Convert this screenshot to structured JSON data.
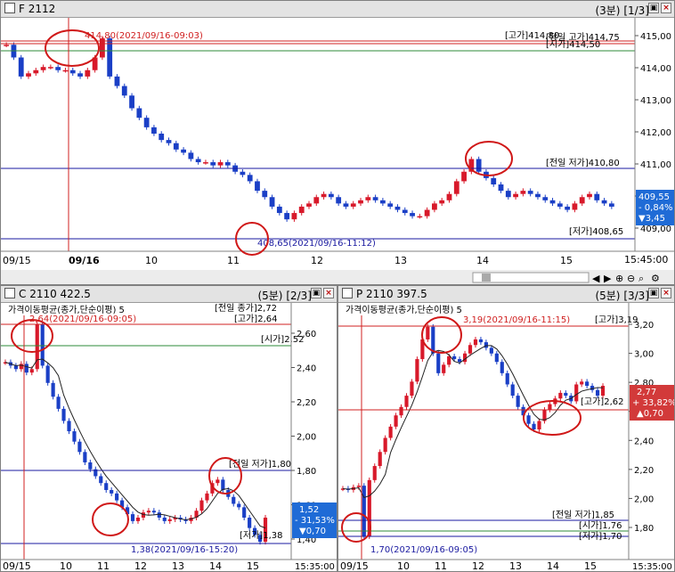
{
  "top": {
    "title": "F 2112",
    "interval": "(3분)",
    "page": "[1/3]",
    "high_label": "[고가]414,80",
    "high_overlap": "[당일 고가]414,75",
    "open_label": "[시가]414,50",
    "prev_low_label": "[전일 저가]410,80",
    "low_label": "[저가]408,65",
    "max_annot": "414,80(2021/09/16-09:03)",
    "min_annot": "408,65(2021/09/16-11:12)",
    "price_box": {
      "price": "409,55",
      "pct": "- 0,84%",
      "chg": "▼3,45"
    },
    "y_ticks": [
      "415,00",
      "414,00",
      "413,00",
      "412,00",
      "411,00",
      "410,00",
      "409,00"
    ],
    "x_ticks": [
      "09/15",
      "09/16",
      "10",
      "11",
      "12",
      "13",
      "14",
      "15"
    ],
    "end_time": "15:45:00",
    "series": [
      414.6,
      414.2,
      413.6,
      413.7,
      413.8,
      413.9,
      413.9,
      413.8,
      413.8,
      413.7,
      413.6,
      413.8,
      414.2,
      414.8,
      413.6,
      413.3,
      413.0,
      412.6,
      412.3,
      412.0,
      411.8,
      411.6,
      411.5,
      411.3,
      411.2,
      411.0,
      410.9,
      410.9,
      410.8,
      410.9,
      410.8,
      410.6,
      410.5,
      410.3,
      410.0,
      409.8,
      409.5,
      409.3,
      409.1,
      409.3,
      409.5,
      409.6,
      409.8,
      409.9,
      409.8,
      409.6,
      409.5,
      409.6,
      409.7,
      409.8,
      409.7,
      409.6,
      409.5,
      409.4,
      409.3,
      409.2,
      409.2,
      409.4,
      409.6,
      409.7,
      409.9,
      410.3,
      410.6,
      411.0,
      410.6,
      410.4,
      410.2,
      410.0,
      409.8,
      409.9,
      410.0,
      409.9,
      409.8,
      409.7,
      409.6,
      409.5,
      409.4,
      409.6,
      409.8,
      409.9,
      409.7,
      409.6,
      409.5
    ]
  },
  "c_panel": {
    "title": "C 2110 422.5",
    "interval": "(5분)",
    "page": "[2/3]",
    "ma_label": "가격이동평균(종가,단순이평) 5",
    "prev_close_label": "[전일 종가]2,72",
    "high_label": "[고가]2,64",
    "open_label": "[시가]2,52",
    "prev_low_label": "[전일 저가]1,80",
    "low_label": "[저가]1,38",
    "max_annot": "2,64(2021/09/16-09:05)",
    "min_annot": "1,38(2021/09/16-15:20)",
    "price_box": {
      "price": "1,52",
      "pct": "- 31,53%",
      "chg": "▼0,70"
    },
    "y_ticks": [
      "2,60",
      "2,40",
      "2,20",
      "2,00",
      "1,80",
      "1,60",
      "1,40"
    ],
    "x_ticks": [
      "09/15",
      "10",
      "11",
      "12",
      "13",
      "14",
      "15"
    ],
    "end_time": "15:35:00",
    "series": [
      2.42,
      2.4,
      2.38,
      2.41,
      2.36,
      2.38,
      2.64,
      2.4,
      2.3,
      2.22,
      2.15,
      2.08,
      2.02,
      1.96,
      1.9,
      1.84,
      1.8,
      1.76,
      1.72,
      1.68,
      1.66,
      1.62,
      1.58,
      1.54,
      1.5,
      1.52,
      1.55,
      1.56,
      1.55,
      1.52,
      1.5,
      1.51,
      1.52,
      1.51,
      1.5,
      1.52,
      1.56,
      1.62,
      1.66,
      1.72,
      1.74,
      1.68,
      1.64,
      1.6,
      1.58,
      1.52,
      1.46,
      1.42,
      1.38,
      1.52
    ]
  },
  "p_panel": {
    "title": "P 2110 397.5",
    "interval": "(5분)",
    "page": "[3/3]",
    "ma_label": "가격이동평균(종가,단순이평) 5",
    "high_label": "[고가]3,19",
    "prev_low_label": "[전일 저가]1,85",
    "open_label": "[시가]1,76",
    "low_label": "[저가]1,70",
    "high2_label": "[고가]2,62",
    "max_annot": "3,19(2021/09/16-11:15)",
    "min_annot": "1,70(2021/09/16-09:05)",
    "price_box": {
      "price": "2,77",
      "pct": "+ 33,82%",
      "chg": "▲0,70"
    },
    "y_ticks": [
      "3,20",
      "3,00",
      "2,80",
      "2,60",
      "2,40",
      "2,20",
      "2,00",
      "1,80"
    ],
    "x_ticks": [
      "09/15",
      "10",
      "11",
      "12",
      "13",
      "14",
      "15"
    ],
    "end_time": "15:35:00",
    "series": [
      2.04,
      2.03,
      2.05,
      2.06,
      1.7,
      2.1,
      2.2,
      2.3,
      2.4,
      2.48,
      2.56,
      2.62,
      2.7,
      2.8,
      2.96,
      3.1,
      3.19,
      3.0,
      2.86,
      2.92,
      2.98,
      2.96,
      2.94,
      3.0,
      3.06,
      3.1,
      3.08,
      3.04,
      3.0,
      2.94,
      2.86,
      2.78,
      2.7,
      2.62,
      2.56,
      2.5,
      2.46,
      2.52,
      2.6,
      2.64,
      2.68,
      2.72,
      2.7,
      2.66,
      2.78,
      2.8,
      2.77,
      2.74,
      2.7,
      2.77
    ]
  },
  "toolbar": {
    "icons": [
      "scroll-left-icon",
      "scroll-right-icon",
      "zoom-in-icon",
      "zoom-out-icon",
      "search-icon",
      "wrench-icon"
    ]
  },
  "colors": {
    "up": "#d8192a",
    "down": "#1a3fc6",
    "high_line": "#d02020",
    "open_line": "#2e8b3a",
    "prev_line": "#1a1aa0",
    "badge_down": "#1f6bd6",
    "badge_up": "#d23a3a"
  }
}
